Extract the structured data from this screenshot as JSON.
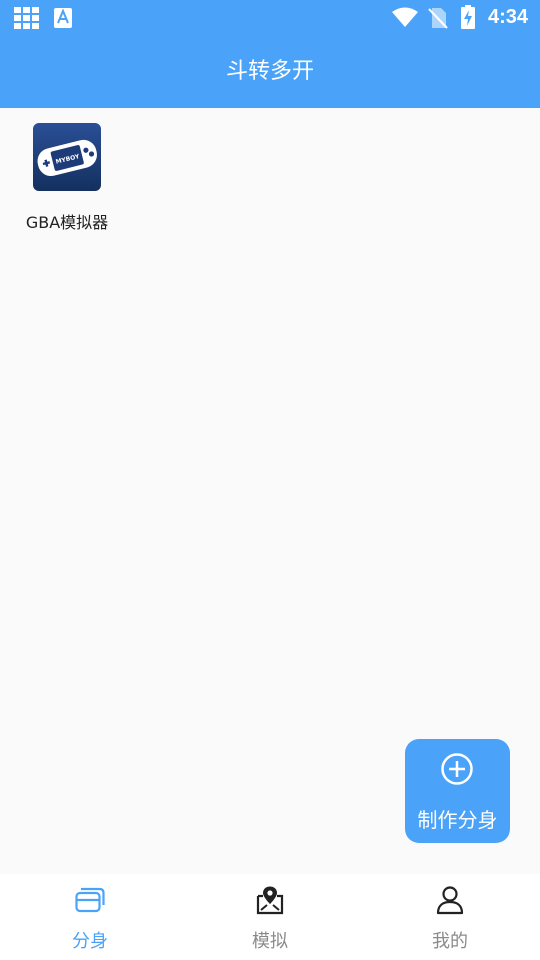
{
  "status_bar": {
    "time": "4:34",
    "icons": [
      "grid-icon",
      "a-icon",
      "wifi-icon",
      "no-sim-icon",
      "battery-charging-icon"
    ]
  },
  "app_bar": {
    "title": "斗转多开"
  },
  "apps": [
    {
      "label": "GBA模拟器",
      "icon": "gba-emulator-icon"
    }
  ],
  "fab": {
    "label": "制作分身",
    "icon": "plus-circle-icon"
  },
  "bottom_nav": {
    "items": [
      {
        "label": "分身",
        "icon": "cards-icon",
        "active": true
      },
      {
        "label": "模拟",
        "icon": "map-pin-icon",
        "active": false
      },
      {
        "label": "我的",
        "icon": "user-icon",
        "active": false
      }
    ]
  },
  "colors": {
    "accent": "#4aa3f9",
    "background": "#fafafa",
    "nav_inactive": "#8a8a8a"
  }
}
